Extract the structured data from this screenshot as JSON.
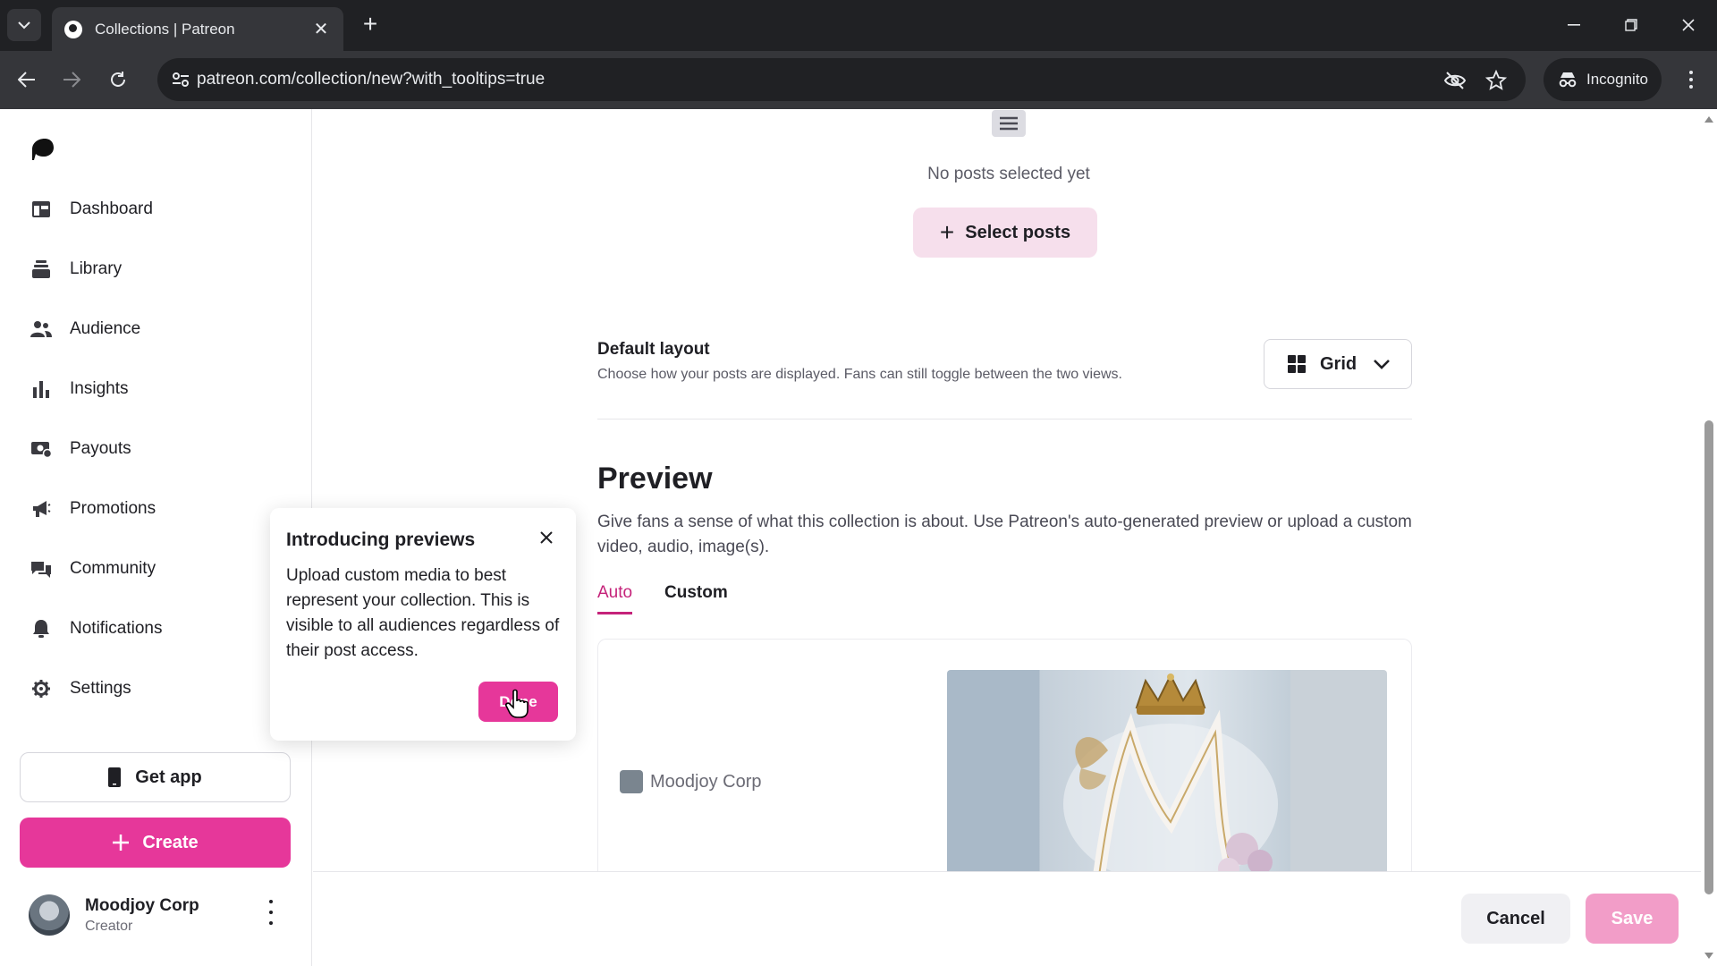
{
  "browser": {
    "tab_title": "Collections | Patreon",
    "url": "patreon.com/collection/new?with_tooltips=true",
    "incognito_label": "Incognito"
  },
  "sidebar": {
    "items": [
      {
        "label": "Dashboard",
        "icon": "dashboard-icon"
      },
      {
        "label": "Library",
        "icon": "library-icon"
      },
      {
        "label": "Audience",
        "icon": "audience-icon"
      },
      {
        "label": "Insights",
        "icon": "insights-icon"
      },
      {
        "label": "Payouts",
        "icon": "payouts-icon"
      },
      {
        "label": "Promotions",
        "icon": "promotions-icon"
      },
      {
        "label": "Community",
        "icon": "community-icon"
      },
      {
        "label": "Notifications",
        "icon": "bell-icon"
      },
      {
        "label": "Settings",
        "icon": "gear-icon"
      }
    ],
    "get_app_label": "Get app",
    "create_label": "Create",
    "profile": {
      "name": "Moodjoy Corp",
      "role": "Creator"
    }
  },
  "tooltip": {
    "title": "Introducing previews",
    "body": "Upload custom media to best represent your collection. This is visible to all audiences regardless of their post access.",
    "done_label": "Done"
  },
  "posts": {
    "empty_text": "No posts selected yet",
    "select_label": "Select posts"
  },
  "default_layout": {
    "title": "Default layout",
    "description": "Choose how your posts are displayed. Fans can still toggle between the two views.",
    "selected": "Grid"
  },
  "preview": {
    "title": "Preview",
    "description": "Give fans a sense of what this collection is about. Use Patreon's auto-generated preview or upload a custom video, audio, image(s).",
    "tabs": [
      {
        "label": "Auto",
        "active": true
      },
      {
        "label": "Custom",
        "active": false
      }
    ],
    "creator_name": "Moodjoy Corp"
  },
  "actions": {
    "cancel_label": "Cancel",
    "save_label": "Save"
  },
  "colors": {
    "brand_pink": "#e6379a",
    "save_disabled": "#f29dc8",
    "active_tab": "#c5237a"
  }
}
